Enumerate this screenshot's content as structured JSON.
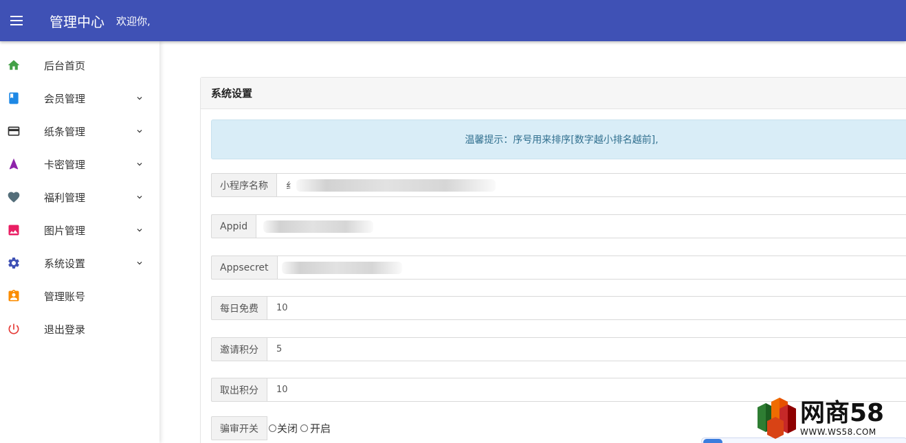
{
  "header": {
    "title": "管理中心",
    "welcome": "欢迎你,"
  },
  "sidebar": {
    "items": [
      {
        "label": "后台首页",
        "icon": "home-icon",
        "color": "#43a047",
        "expandable": false
      },
      {
        "label": "会员管理",
        "icon": "book-icon",
        "color": "#1e88e5",
        "expandable": true
      },
      {
        "label": "纸条管理",
        "icon": "card-icon",
        "color": "#333333",
        "expandable": true
      },
      {
        "label": "卡密管理",
        "icon": "navigation-icon",
        "color": "#8e24aa",
        "expandable": true
      },
      {
        "label": "福利管理",
        "icon": "heart-icon",
        "color": "#546e7a",
        "expandable": true
      },
      {
        "label": "图片管理",
        "icon": "image-icon",
        "color": "#e91e63",
        "expandable": true
      },
      {
        "label": "系统设置",
        "icon": "gear-icon",
        "color": "#3f51b5",
        "expandable": true
      },
      {
        "label": "管理账号",
        "icon": "account-badge-icon",
        "color": "#fb8c00",
        "expandable": false
      },
      {
        "label": "退出登录",
        "icon": "power-icon",
        "color": "#e53935",
        "expandable": false
      }
    ]
  },
  "card": {
    "title": "系统设置",
    "tip": "温馨提示：序号用来排序[数字越小排名越前],"
  },
  "form": {
    "app_name": {
      "label": "小程序名称",
      "value": "纟"
    },
    "appid": {
      "label": "Appid",
      "value": ""
    },
    "appsecret": {
      "label": "Appsecret",
      "value": ""
    },
    "daily_free": {
      "label": "每日免费",
      "value": "10"
    },
    "invite_points": {
      "label": "邀请积分",
      "value": "5"
    },
    "withdraw_points": {
      "label": "取出积分",
      "value": "10"
    },
    "review_switch": {
      "label": "骗审开关",
      "options": [
        "关闭",
        "开启"
      ]
    }
  },
  "watermark": {
    "brand": "网商58",
    "url": "WWW.WS58.COM"
  },
  "colors": {
    "topbar": "#3f51b5",
    "tip_bg": "#d9edf7",
    "tip_text": "#31708f"
  }
}
